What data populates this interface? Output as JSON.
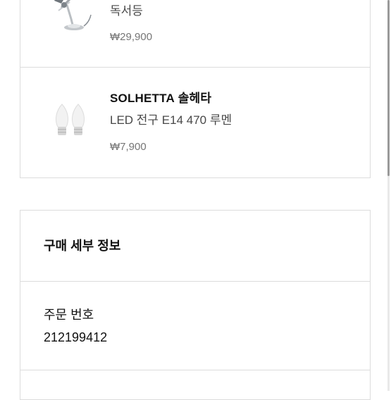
{
  "products": [
    {
      "name": "",
      "description": "독서등",
      "price": "₩29,900",
      "icon": "desk-lamp-icon"
    },
    {
      "brand": "SOLHETTA",
      "name_local": "솔헤타",
      "description": "LED 전구 E14 470 루멘",
      "price": "₩7,900",
      "icon": "led-bulb-icon"
    }
  ],
  "purchase_details": {
    "title": "구매 세부 정보",
    "order_number_label": "주문 번호",
    "order_number_value": "212199412"
  },
  "colors": {
    "border": "#dcdcdc",
    "text_primary": "#111111",
    "text_secondary": "#484848",
    "text_price": "#767676"
  }
}
